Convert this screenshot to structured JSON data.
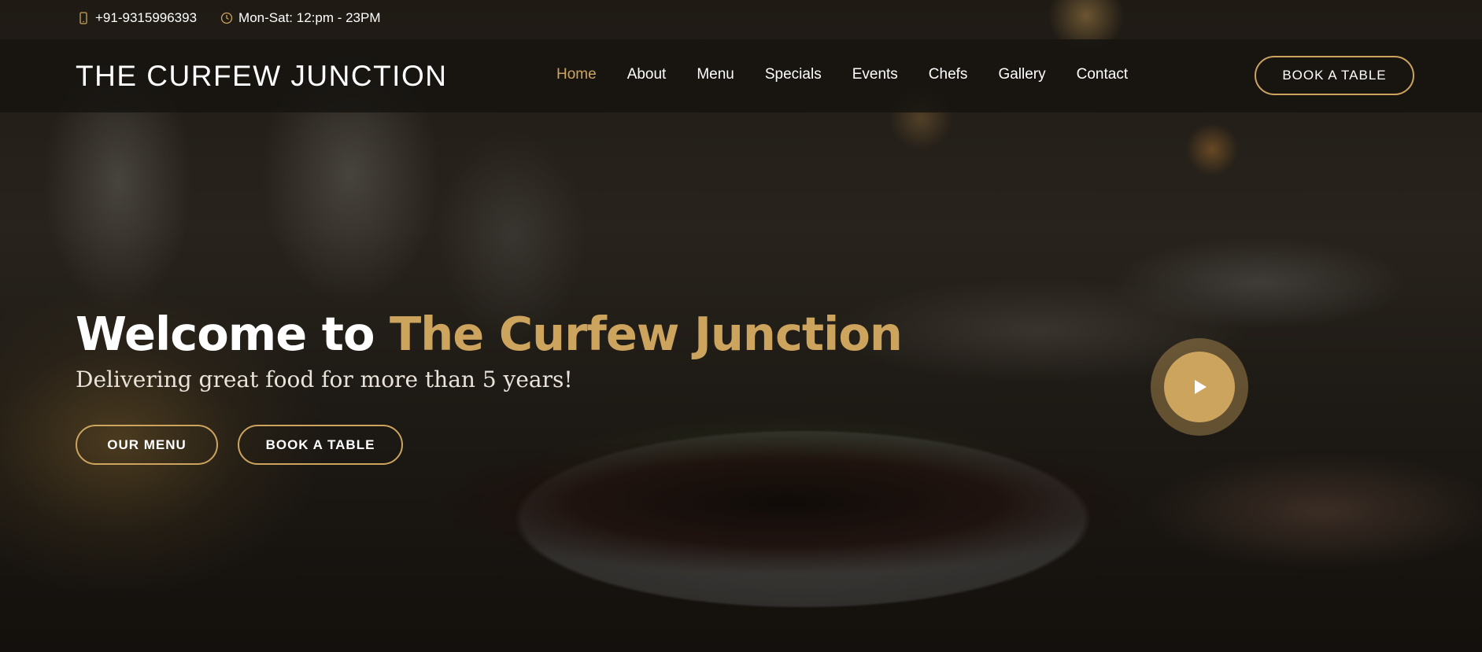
{
  "topbar": {
    "phone": "+91-9315996393",
    "hours": "Mon-Sat: 12:pm - 23PM",
    "phone_icon": "mobile-phone-icon",
    "hours_icon": "clock-icon"
  },
  "header": {
    "logo": "THE CURFEW JUNCTION",
    "nav": [
      {
        "label": "Home",
        "active": true
      },
      {
        "label": "About"
      },
      {
        "label": "Menu"
      },
      {
        "label": "Specials"
      },
      {
        "label": "Events"
      },
      {
        "label": "Chefs"
      },
      {
        "label": "Gallery"
      },
      {
        "label": "Contact"
      }
    ],
    "cta": "BOOK A TABLE"
  },
  "hero": {
    "title_prefix": "Welcome to",
    "title_accent": "The Curfew Junction",
    "subtitle": "Delivering great food for more than 5 years!",
    "buttons": {
      "menu": "OUR MENU",
      "book": "BOOK A TABLE"
    },
    "play_icon": "play-icon"
  },
  "colors": {
    "accent": "#cda45e",
    "header_bg": "#161411"
  }
}
